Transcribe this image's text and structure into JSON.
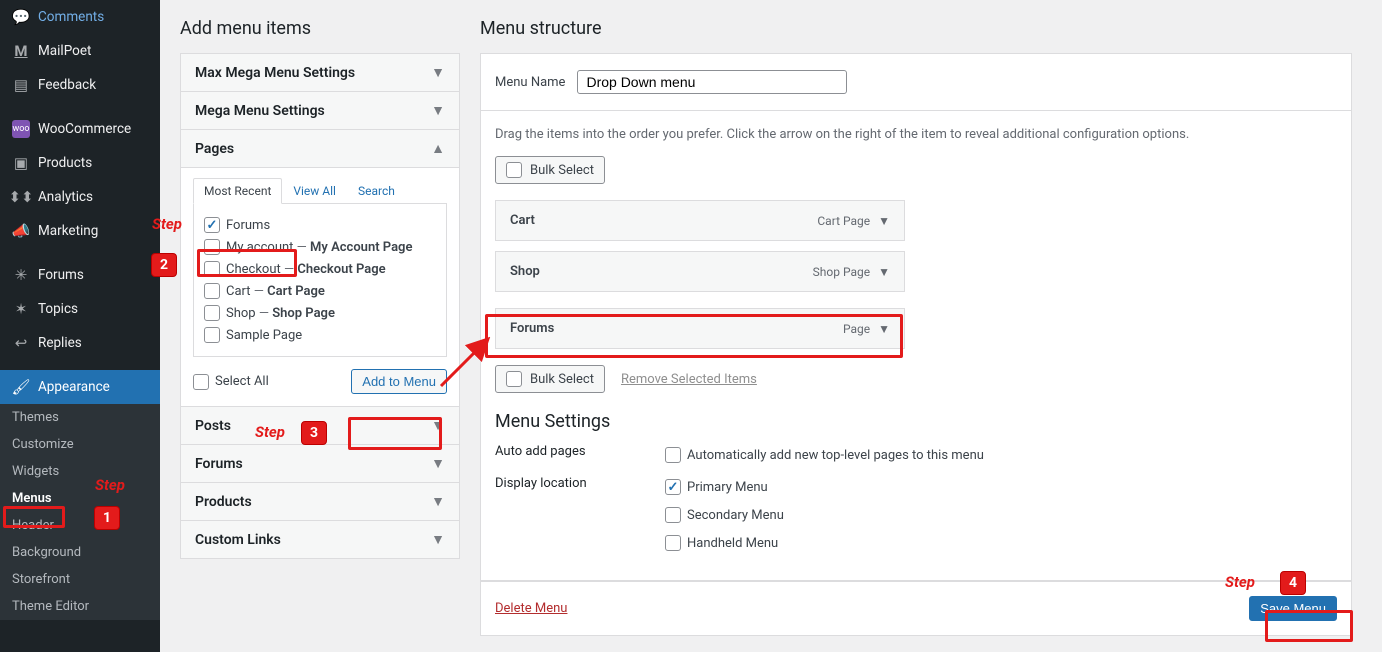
{
  "sidebar": {
    "items": [
      {
        "label": "Comments",
        "icon": "💬"
      },
      {
        "label": "MailPoet",
        "icon": "M"
      },
      {
        "label": "Feedback",
        "icon": "▤"
      },
      {
        "label": "WooCommerce",
        "icon": "woo"
      },
      {
        "label": "Products",
        "icon": "📦"
      },
      {
        "label": "Analytics",
        "icon": "📊"
      },
      {
        "label": "Marketing",
        "icon": "📣"
      },
      {
        "label": "Forums",
        "icon": "✳"
      },
      {
        "label": "Topics",
        "icon": "✶"
      },
      {
        "label": "Replies",
        "icon": "↩"
      },
      {
        "label": "Appearance",
        "icon": "🖌"
      }
    ],
    "sub": {
      "items": [
        "Themes",
        "Customize",
        "Widgets",
        "Menus",
        "Header",
        "Background",
        "Storefront",
        "Theme Editor"
      ],
      "current": "Menus"
    }
  },
  "left": {
    "title": "Add menu items",
    "panels": [
      {
        "label": "Max Mega Menu Settings"
      },
      {
        "label": "Mega Menu Settings"
      },
      {
        "label": "Pages",
        "open": true
      },
      {
        "label": "Posts"
      },
      {
        "label": "Forums"
      },
      {
        "label": "Products"
      },
      {
        "label": "Custom Links"
      }
    ],
    "tabs": [
      "Most Recent",
      "View All",
      "Search"
    ],
    "active_tab": "Most Recent",
    "pages": [
      {
        "label": "Forums",
        "checked": true
      },
      {
        "label": "My account",
        "suffix": "My Account Page"
      },
      {
        "label": "Checkout",
        "suffix": "Checkout Page"
      },
      {
        "label": "Cart",
        "suffix": "Cart Page"
      },
      {
        "label": "Shop",
        "suffix": "Shop Page"
      },
      {
        "label": "Sample Page"
      }
    ],
    "select_all": "Select All",
    "add_btn": "Add to Menu"
  },
  "right": {
    "title": "Menu structure",
    "menu_name_label": "Menu Name",
    "menu_name_value": "Drop Down menu",
    "hint": "Drag the items into the order you prefer. Click the arrow on the right of the item to reveal additional configuration options.",
    "bulk": "Bulk Select",
    "remove": "Remove Selected Items",
    "menu_items": [
      {
        "label": "Cart",
        "type": "Cart Page"
      },
      {
        "label": "Shop",
        "type": "Shop Page"
      },
      {
        "label": "Forums",
        "type": "Page",
        "highlight": true
      }
    ],
    "settings_title": "Menu Settings",
    "auto_label": "Auto add pages",
    "auto_chk": "Automatically add new top-level pages to this menu",
    "loc_label": "Display location",
    "locations": [
      {
        "label": "Primary Menu",
        "checked": true
      },
      {
        "label": "Secondary Menu"
      },
      {
        "label": "Handheld Menu"
      }
    ],
    "delete": "Delete Menu",
    "save": "Save Menu"
  },
  "steps": {
    "s": "Step"
  }
}
